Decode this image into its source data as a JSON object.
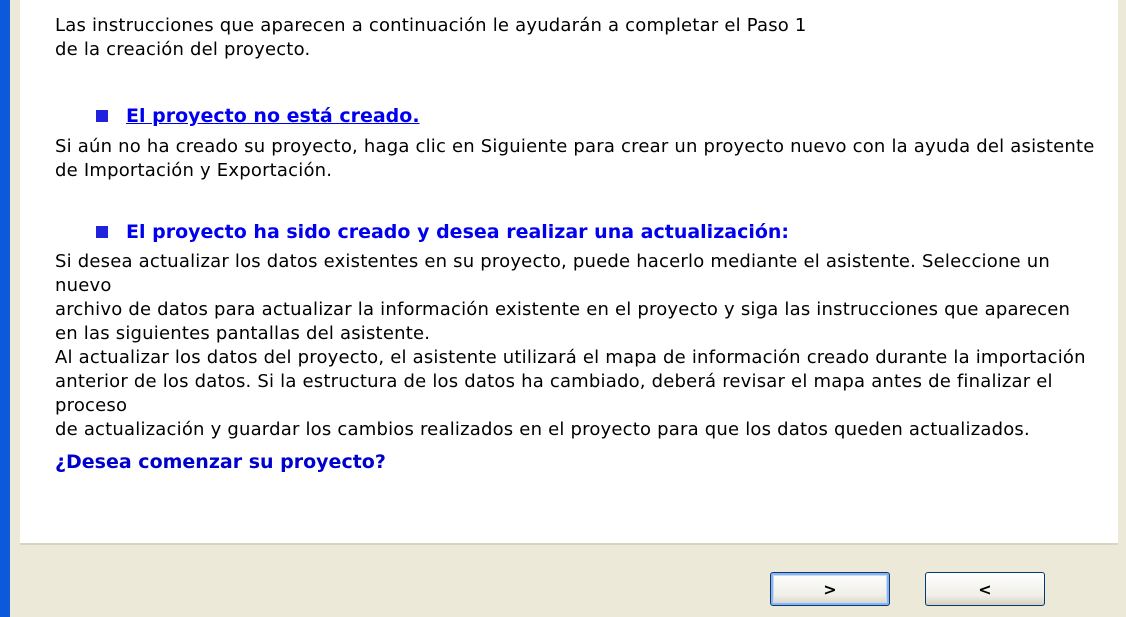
{
  "content": {
    "intro_lines": [
      "Las instrucciones que aparecen a continuación le ayudarán a completar el Paso 1",
      "de la creación del proyecto."
    ],
    "section1": {
      "heading": "El proyecto no está creado.",
      "lines": [
        "Si aún no ha creado su proyecto, haga clic en Siguiente para crear un proyecto nuevo con la ayuda del asistente",
        "de Importación y Exportación."
      ]
    },
    "section2": {
      "heading": "El proyecto ha sido creado y desea realizar una actualización:",
      "lines": [
        "Si desea actualizar los datos existentes en su proyecto, puede hacerlo mediante el asistente. Seleccione un nuevo",
        "archivo de datos para actualizar la información existente en el proyecto y siga las instrucciones que aparecen",
        "en las siguientes pantallas del asistente.",
        "Al actualizar los datos del proyecto, el asistente utilizará el mapa de información creado durante la importación",
        "anterior de los datos. Si la estructura de los datos ha cambiado, deberá revisar el mapa antes de finalizar el proceso",
        "de actualización y guardar los cambios realizados en el proyecto para que los datos queden actualizados."
      ]
    },
    "bottom_link": "¿Desea comenzar su proyecto?"
  },
  "buttons": {
    "next_label": ">",
    "back_label": "<"
  },
  "colors": {
    "link_blue": "#0000ee",
    "border_blue": "#0a5adb",
    "panel_bg": "#ece9d8"
  }
}
